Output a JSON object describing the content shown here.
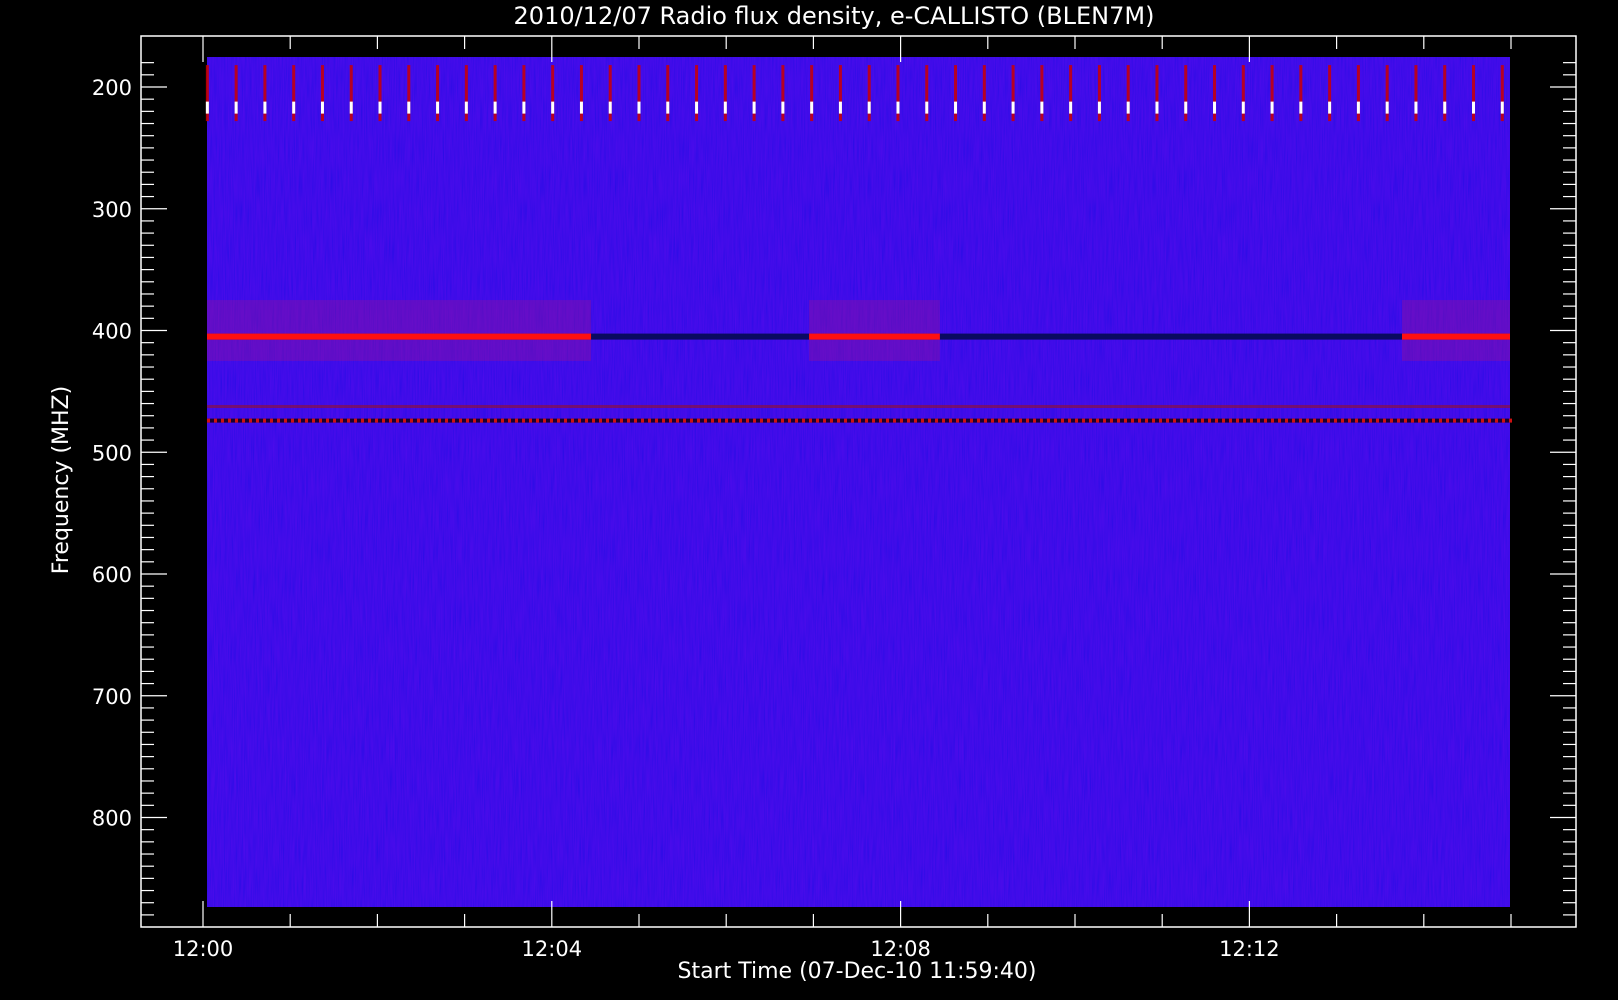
{
  "chart_data": {
    "type": "heatmap",
    "title": "2010/12/07  Radio flux density, e-CALLISTO (BLEN7M)",
    "xlabel": "Start Time (07-Dec-10 11:59:40)",
    "ylabel": "Frequency (MHZ)",
    "x_ticks": [
      "12:00",
      "12:04",
      "12:08",
      "12:12"
    ],
    "y_ticks": [
      "200",
      "300",
      "400",
      "500",
      "600",
      "700",
      "800"
    ],
    "x_range_minutes": [
      11.9,
      15.0
    ],
    "y_range_mhz": [
      176,
      872
    ],
    "y_reversed": true,
    "colors": {
      "background": "#000000",
      "low": "#1a10f0",
      "mid": "#cc0000",
      "high": "#ffffff"
    },
    "features": [
      {
        "name": "periodic-bursts",
        "freq_mhz": [
          182,
          228
        ],
        "period_minutes": 0.33
      },
      {
        "name": "carrier-band",
        "freq_mhz": 405,
        "active_minutes": [
          [
            0.0,
            4.45
          ],
          [
            6.95,
            8.45
          ],
          [
            13.75,
            15.0
          ]
        ]
      },
      {
        "name": "interference-line",
        "freq_mhz": 474
      },
      {
        "name": "interference-line-faint",
        "freq_mhz": 462
      }
    ]
  }
}
